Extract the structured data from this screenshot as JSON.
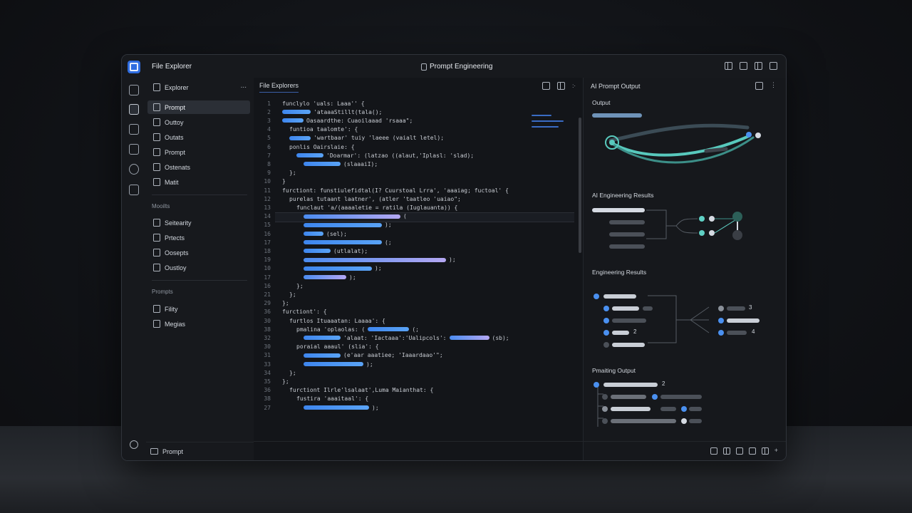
{
  "titlebar": {
    "left_title": "File Explorer",
    "center_title": "Prompt Engineering"
  },
  "explorer": {
    "header": "Explorer",
    "more": "...",
    "items": [
      "Prompt",
      "Outtoy",
      "Outats",
      "Prompt",
      "Ostenats",
      "Matit"
    ],
    "section1_title": "Mooilts",
    "section1_items": [
      "Seitearity",
      "Prtects",
      "Oosepts",
      "Oustloy"
    ],
    "section2_title": "Prompts",
    "section2_items": [
      "Fility",
      "Megias"
    ],
    "footer_label": "Prompt"
  },
  "editor": {
    "tab_label": "File Explorers",
    "tab_more": ":·",
    "line_numbers": [
      "1",
      "2",
      "3",
      "4",
      "5",
      "6",
      "7",
      "8",
      "9",
      "10",
      "11",
      "12",
      "13",
      "14",
      "15",
      "16",
      "17",
      "18",
      "19",
      "10",
      "17",
      "16",
      "21",
      "29",
      "36",
      "30",
      "38",
      "32",
      "30",
      "31",
      "33",
      "34",
      "35",
      "36",
      "38",
      "27"
    ],
    "code": {
      "l1a": "funclylo 'uals: Laaa'' {",
      "l2a": "'ataaaStillt(tala();",
      "l3a": "Oasaardthe: Cuaoilaaad 'rsaaa\";",
      "l4a": "funtioa taalomte': {",
      "l5a": "'wartbaar' tuiy 'laeee (vaialt letel);",
      "l6a": "ponlis Oairslaie: {",
      "l7a": "'Doarmar': (latzao ((alaut,'Iplasl: 'slad);",
      "l8a": "(slaaaiI);",
      "l9a": "};",
      "l10a": "}",
      "l11a": "furctiont: funstiulefidtal(I? Cuurstoal Lrra', 'aaaiag; fuctoal' {",
      "l12a": "purelas tutaant laatner', (atler 'taatleo 'uaiao\";",
      "l13a": "funclaut 'a/(aaaaletie = ratila  (Iuglauanta)) {",
      "l14a": "(",
      "l15a": ");",
      "l16a": "(sel);",
      "l17a": "(;",
      "l18a": "(utlalat);",
      "l19a": ");",
      "l20a": ");",
      "l21a": ");",
      "l22a": "};",
      "l23a": "};",
      "l24a": "};",
      "l25a": "furctiont': {",
      "l26a": "furtlos Ituaaatan: Laaaa': {",
      "l27a": "pmalina 'oplaolas: (",
      "l27b": "(;",
      "l28a": "'alaat: 'Iactaaa':'Ualipcols':",
      "l28b": "(sb);",
      "l29a": "poraial aaaul' (slia': {",
      "l30a": "(e'aar aaatiee; 'Iaaardaao'\";",
      "l31a": ");",
      "l32a": "};",
      "l33a": "};",
      "l34a": "furctiont Ilrle'lsalaat',Luma Maianthat: {",
      "l35a": "fustira 'aaaitaal': {",
      "l36a": ");",
      "l37a": "};",
      "l38a": "};"
    }
  },
  "output": {
    "header": "AI Prompt Output",
    "section1": "Output",
    "section2": "AI Engineering Results",
    "section3": "Engineering Results",
    "section3_labels": [
      "2",
      "3",
      "4"
    ],
    "section4": "Pmaiting Output",
    "section4_labels": [
      "2"
    ]
  },
  "colors": {
    "accent_blue": "#4a90f0",
    "accent_teal": "#5fd0c4",
    "accent_purple": "#b6a8f3",
    "panel_bg": "#16181c"
  }
}
